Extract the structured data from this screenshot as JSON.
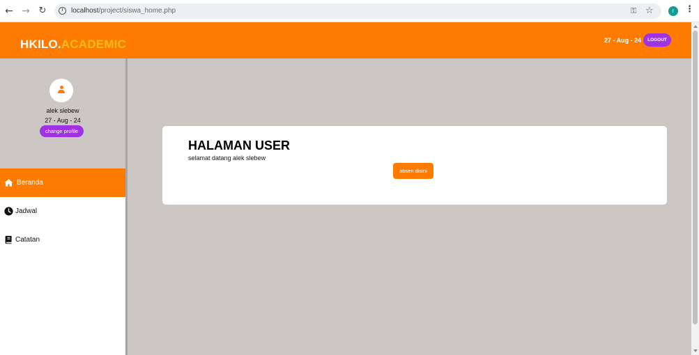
{
  "browser": {
    "url_host": "localhost",
    "url_path": "/project/siswa_home.php",
    "profile_initial": "r"
  },
  "header": {
    "brand_main": "HKILO.",
    "brand_accent": "ACADEMIC",
    "date": "27 - Aug - 24",
    "logout_label": "LOGOUT"
  },
  "sidebar": {
    "user_name": "alek slebew",
    "user_date": "27 - Aug - 24",
    "change_profile_label": "change profile",
    "items": [
      {
        "label": "Beranda",
        "icon": "home-icon",
        "active": true
      },
      {
        "label": "Jadwal",
        "icon": "clock-icon",
        "active": false
      },
      {
        "label": "Catatan",
        "icon": "book-icon",
        "active": false
      }
    ]
  },
  "main": {
    "title": "HALAMAN USER",
    "welcome": "selamat datang alek slebew",
    "absen_label": "absen disini"
  },
  "colors": {
    "accent_orange": "#ff7b00",
    "brand_yellow": "#ffbb18",
    "button_purple": "#9f33e3",
    "content_bg": "#ccc7c3"
  }
}
